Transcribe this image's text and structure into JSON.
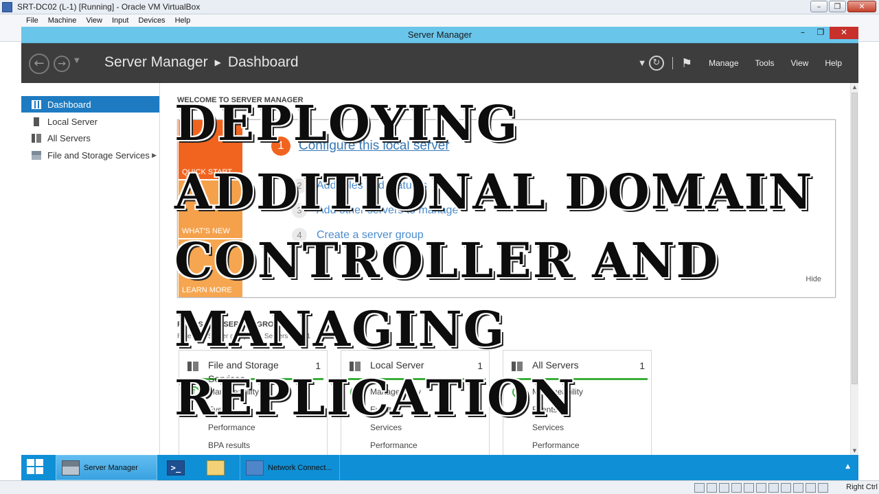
{
  "vbox": {
    "title": "SRT-DC02 (L-1) [Running] - Oracle VM VirtualBox",
    "menu": [
      "File",
      "Machine",
      "View",
      "Input",
      "Devices",
      "Help"
    ],
    "host_key": "Right Ctrl"
  },
  "server_manager": {
    "window_title": "Server Manager",
    "breadcrumb": [
      "Server Manager",
      "Dashboard"
    ],
    "header_menu": [
      "Manage",
      "Tools",
      "View",
      "Help"
    ]
  },
  "sidebar": {
    "items": [
      {
        "label": "Dashboard",
        "active": true,
        "icon": "dashboard-icon"
      },
      {
        "label": "Local Server",
        "active": false,
        "icon": "server-icon"
      },
      {
        "label": "All Servers",
        "active": false,
        "icon": "servers-icon"
      },
      {
        "label": "File and Storage Services",
        "active": false,
        "icon": "storage-icon"
      }
    ]
  },
  "welcome": {
    "heading": "WELCOME TO SERVER MANAGER",
    "tabs": [
      "QUICK START",
      "WHAT'S NEW",
      "LEARN MORE"
    ],
    "steps": [
      {
        "num": "1",
        "label": "Configure this local server"
      },
      {
        "num": "2",
        "label": "Add roles and features"
      },
      {
        "num": "3",
        "label": "Add other servers to manage"
      },
      {
        "num": "4",
        "label": "Create a server group"
      }
    ],
    "hide": "Hide"
  },
  "groups": {
    "heading": "ROLES AND SERVER GROUPS",
    "subheading": "Roles: 1 | Server groups: 1 | Servers total: 1",
    "tiles": [
      {
        "name": "File and Storage Services",
        "count": "1",
        "rows": [
          "Manageability",
          "Events",
          "Performance",
          "BPA results"
        ]
      },
      {
        "name": "Local Server",
        "count": "1",
        "rows": [
          "Manageability",
          "Events",
          "Services",
          "Performance"
        ]
      },
      {
        "name": "All Servers",
        "count": "1",
        "rows": [
          "Manageability",
          "Events",
          "Services",
          "Performance"
        ]
      }
    ]
  },
  "taskbar": {
    "items": [
      {
        "label": "Server Manager",
        "icon": "server-manager-icon",
        "open": true
      },
      {
        "label": "",
        "icon": "powershell-icon",
        "open": false
      },
      {
        "label": "",
        "icon": "file-explorer-icon",
        "open": false
      },
      {
        "label": "Network Connect...",
        "icon": "network-connections-icon",
        "open": false
      }
    ]
  },
  "overlay_title": [
    "DEPLOYING",
    "ADDITIONAL DOMAIN",
    "CONTROLLER AND",
    "MANAGING",
    "REPLICATION"
  ]
}
